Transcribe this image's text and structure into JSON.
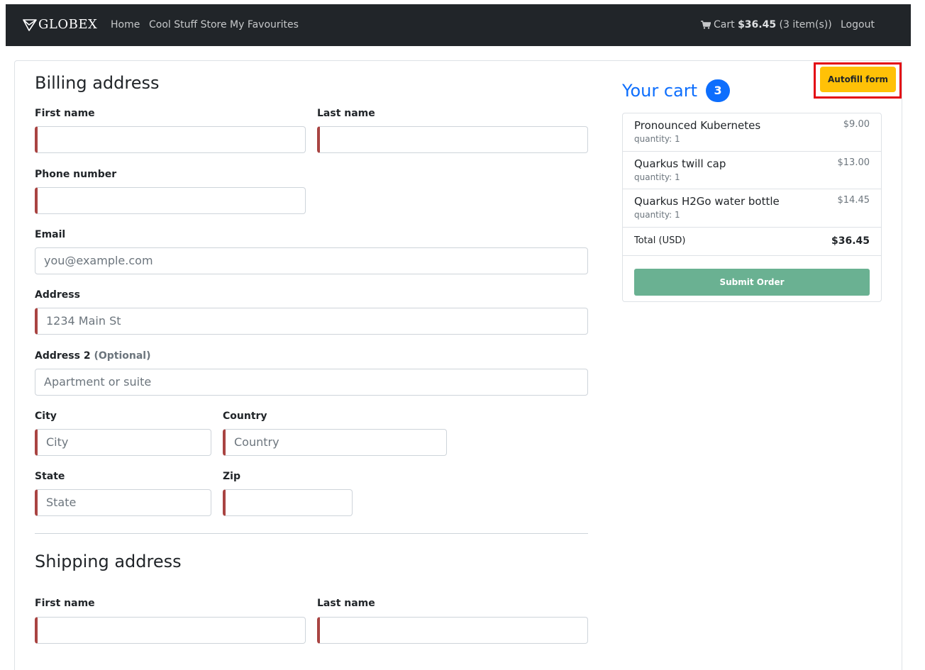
{
  "navbar": {
    "brand": "GLOBEX",
    "links": [
      "Home",
      "Cool Stuff Store",
      "My Favourites"
    ],
    "cart_prefix": "Cart",
    "cart_amount": "$36.45",
    "cart_items_text": "(3 item(s))",
    "logout": "Logout"
  },
  "billing": {
    "title": "Billing address",
    "first_name_label": "First name",
    "last_name_label": "Last name",
    "phone_label": "Phone number",
    "email_label": "Email",
    "email_placeholder": "you@example.com",
    "address_label": "Address",
    "address_placeholder": "1234 Main St",
    "address2_label": "Address 2",
    "address2_optional": "(Optional)",
    "address2_placeholder": "Apartment or suite",
    "city_label": "City",
    "city_placeholder": "City",
    "country_label": "Country",
    "country_placeholder": "Country",
    "state_label": "State",
    "state_placeholder": "State",
    "zip_label": "Zip"
  },
  "shipping": {
    "title": "Shipping address",
    "first_name_label": "First name",
    "last_name_label": "Last name"
  },
  "autofill": {
    "label": "Autofill form"
  },
  "cart": {
    "title": "Your cart",
    "badge": "3",
    "items": [
      {
        "name": "Pronounced Kubernetes",
        "quantity": "quantity: 1",
        "price": "$9.00"
      },
      {
        "name": "Quarkus twill cap",
        "quantity": "quantity: 1",
        "price": "$13.00"
      },
      {
        "name": "Quarkus H2Go water bottle",
        "quantity": "quantity: 1",
        "price": "$14.45"
      }
    ],
    "total_label": "Total (USD)",
    "total_value": "$36.45",
    "submit_label": "Submit Order"
  },
  "colors": {
    "navbar_bg": "#212529",
    "required_border": "#a94442",
    "autofill_button": "#ffc107",
    "autofill_highlight": "#e30613",
    "cart_accent": "#0d6efd",
    "submit_button": "#6ab192"
  }
}
